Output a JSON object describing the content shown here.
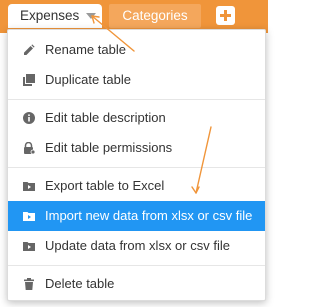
{
  "tabs": {
    "active_label": "Expenses",
    "second_label": "Categories"
  },
  "background": {
    "hint_text": "p"
  },
  "menu": {
    "items": [
      {
        "label": "Rename table",
        "icon": "pencil-icon"
      },
      {
        "label": "Duplicate table",
        "icon": "duplicate-icon"
      },
      {
        "label": "Edit table description",
        "icon": "info-icon"
      },
      {
        "label": "Edit table permissions",
        "icon": "lock-icon"
      },
      {
        "label": "Export table to Excel",
        "icon": "export-icon"
      },
      {
        "label": "Import new data from xlsx or csv file",
        "icon": "import-icon"
      },
      {
        "label": "Update data from xlsx or csv file",
        "icon": "update-icon"
      },
      {
        "label": "Delete table",
        "icon": "trash-icon"
      }
    ],
    "highlighted_index": 5
  },
  "colors": {
    "accent": "#f0953a",
    "highlight": "#2196f3",
    "icon": "#666666"
  }
}
